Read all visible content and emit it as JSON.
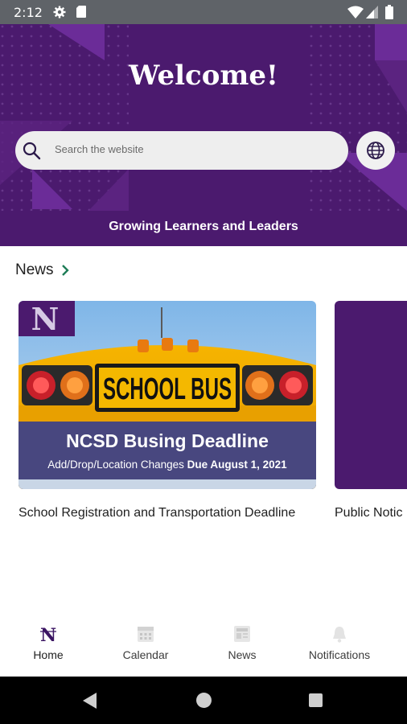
{
  "status_bar": {
    "time": "2:12",
    "icons": [
      "gear-icon",
      "sd-card-icon",
      "wifi-icon",
      "signal-icon",
      "battery-icon"
    ]
  },
  "hero": {
    "title": "Welcome!",
    "search": {
      "placeholder": "Search the website"
    },
    "tagline": "Growing Learners and Leaders"
  },
  "news": {
    "section_title": "News",
    "cards": [
      {
        "image": {
          "logo_letter": "N",
          "sign_text": "SCHOOL BUS",
          "banner_title": "NCSD Busing Deadline",
          "banner_subtitle": "Add/Drop/Location Changes",
          "banner_due": "Due August 1, 2021"
        },
        "title": "School Registration and Transportation Deadline"
      },
      {
        "title": "Public Notic"
      }
    ]
  },
  "bottom_nav": {
    "items": [
      {
        "label": "Home",
        "icon": "home-logo-icon",
        "active": true
      },
      {
        "label": "Calendar",
        "icon": "calendar-icon",
        "active": false
      },
      {
        "label": "News",
        "icon": "news-icon",
        "active": false
      },
      {
        "label": "Notifications",
        "icon": "bell-icon",
        "active": false
      }
    ]
  },
  "colors": {
    "brand_purple": "#4b1a6e",
    "accent_purple": "#6b2c98",
    "news_chevron": "#1e7d57",
    "status_bar": "#5f6368"
  }
}
